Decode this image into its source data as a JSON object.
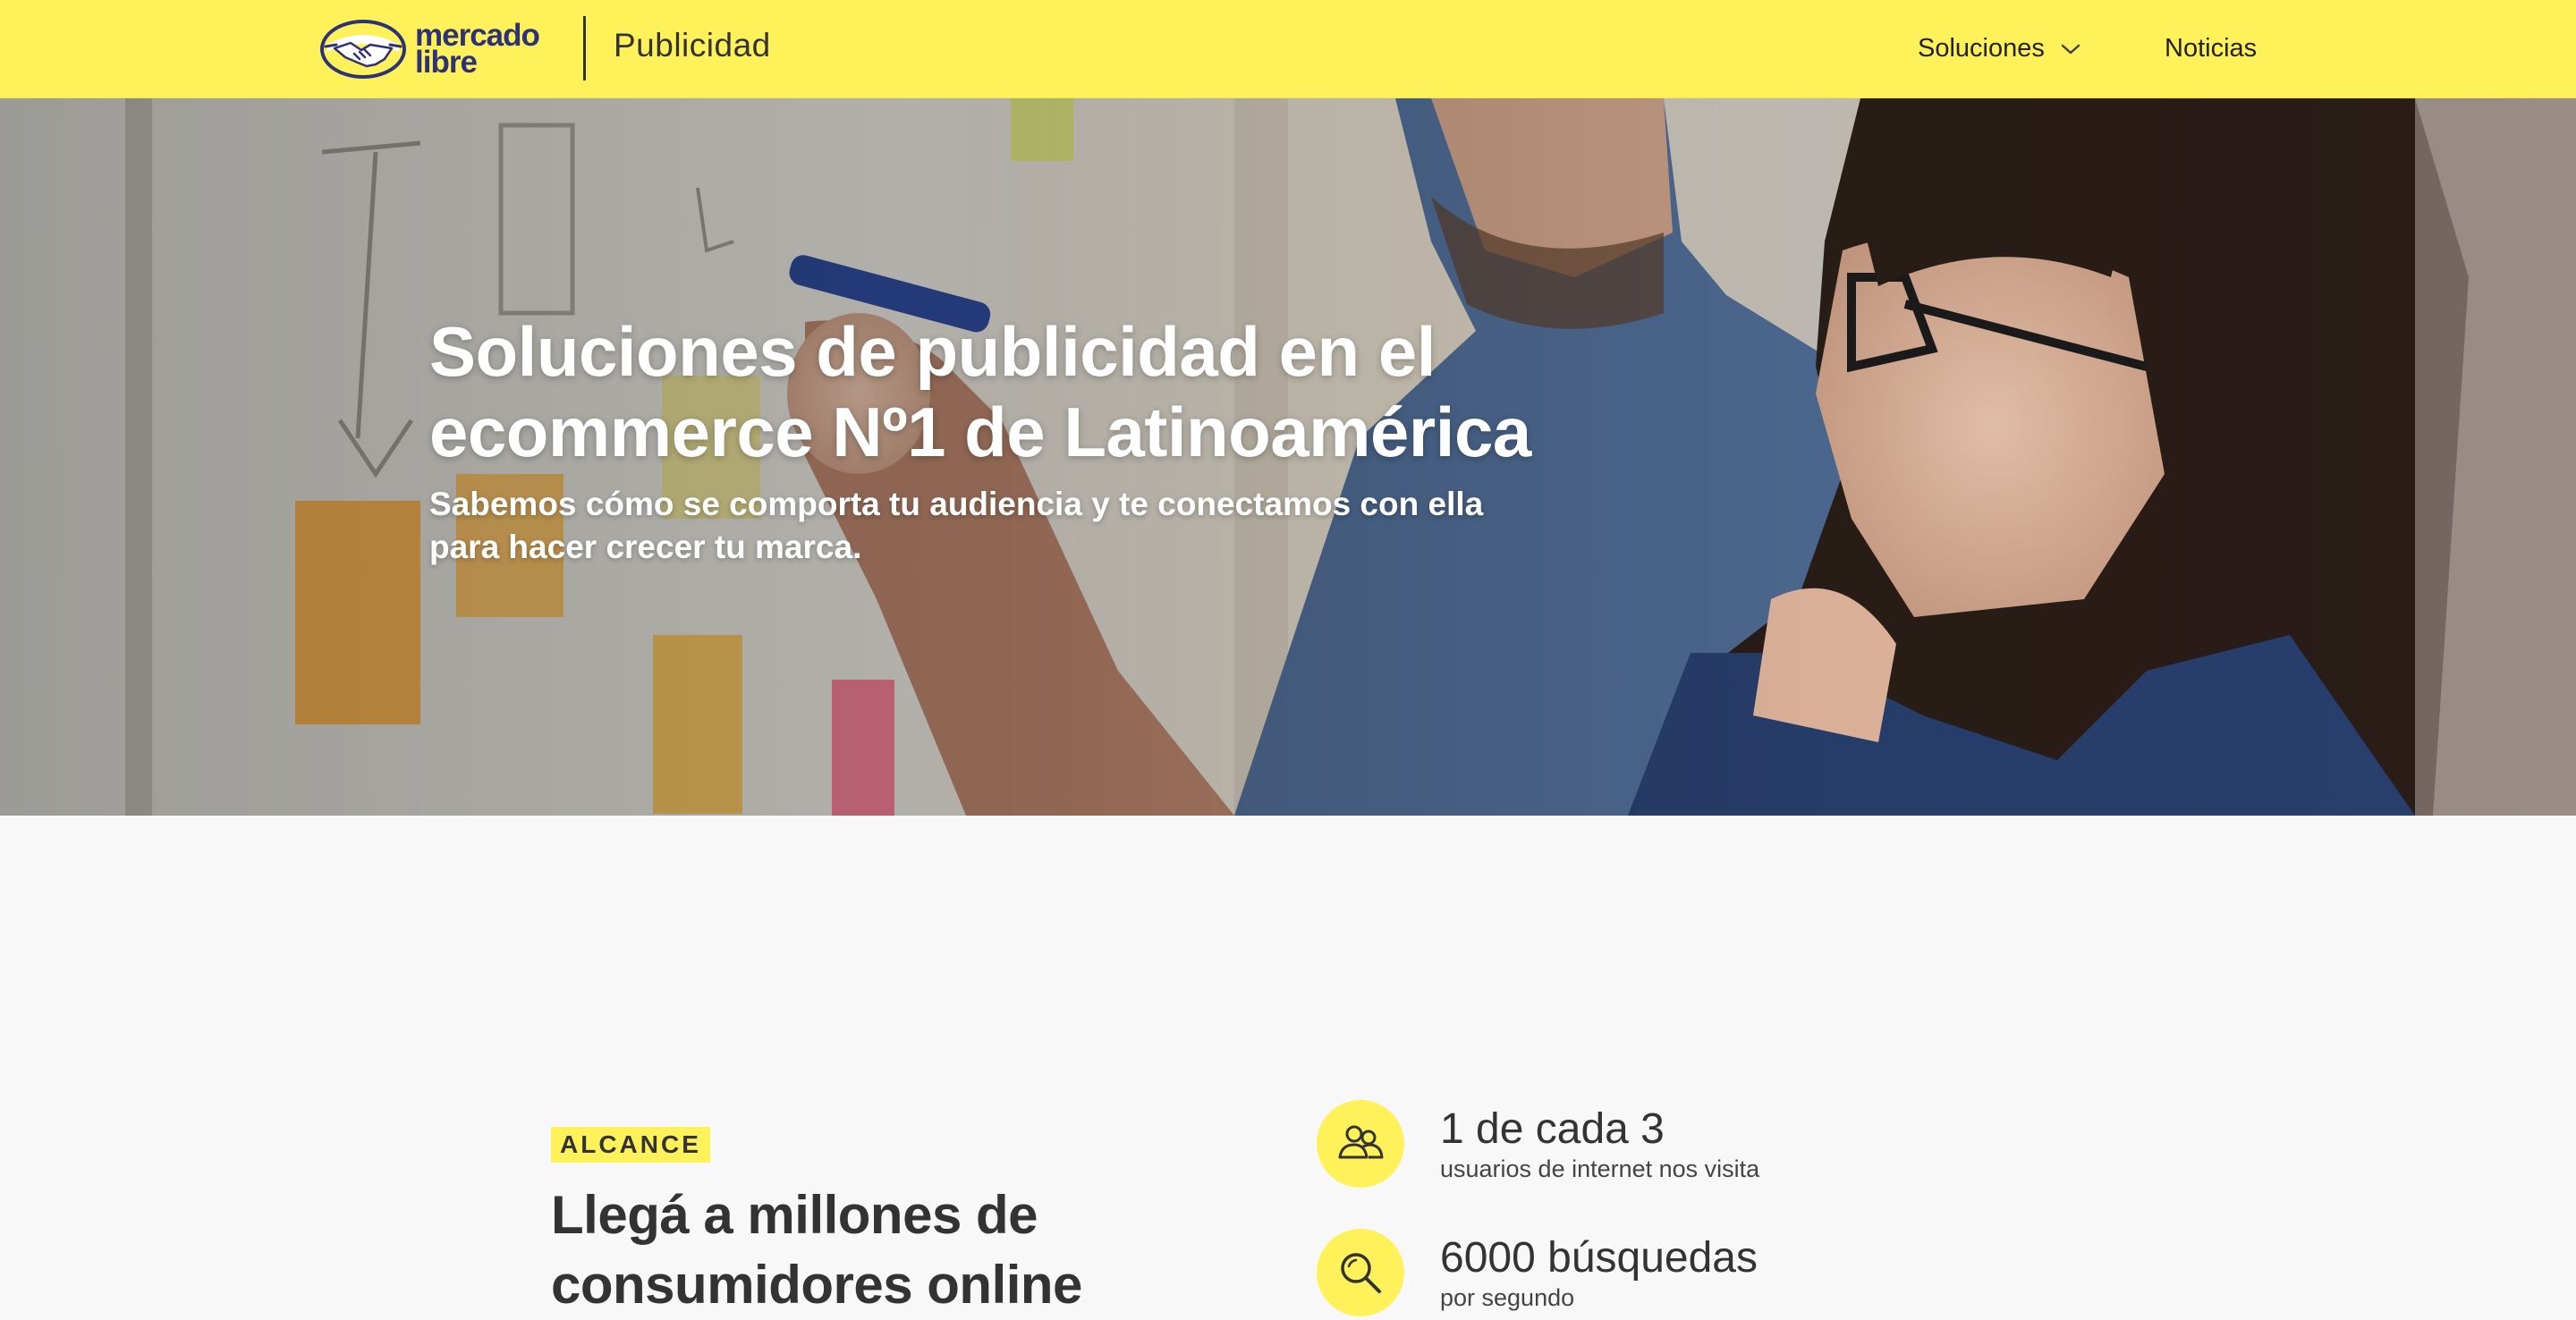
{
  "header": {
    "logo_text_line1": "mercado",
    "logo_text_line2": "libre",
    "product_name": "Publicidad",
    "nav": {
      "solutions_label": "Soluciones",
      "news_label": "Noticias"
    }
  },
  "hero": {
    "title": "Soluciones de publicidad en el ecommerce Nº1 de Latinoamérica",
    "subtitle": "Sabemos cómo se comporta tu audiencia y te conectamos con ella para hacer crecer tu marca."
  },
  "reach": {
    "tag": "ALCANCE",
    "title": "Llegá a millones de consumidores online",
    "stats": [
      {
        "value": "1 de cada 3",
        "label": "usuarios de internet nos visita",
        "icon": "users-icon"
      },
      {
        "value": "6000 búsquedas",
        "label": "por segundo",
        "icon": "search-icon"
      }
    ]
  },
  "colors": {
    "brand_yellow": "#fff159",
    "brand_blue": "#2d3277",
    "text_dark": "#333333",
    "page_background": "#f8f8f8"
  }
}
